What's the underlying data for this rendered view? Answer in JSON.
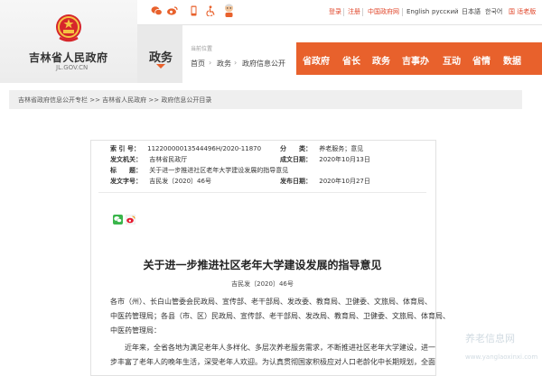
{
  "topbar": {
    "icons": [
      "wechat-icon",
      "weibo-icon",
      "mobile-icon",
      "accessibility-icon",
      "elder-mode-icon"
    ],
    "login": "登录",
    "register": "注册",
    "portal": "中国政府网",
    "languages": [
      "English",
      "русский",
      "日本語",
      "한국어"
    ],
    "old_version": "国 适老版"
  },
  "header": {
    "site_name": "吉林省人民政府",
    "domain": "JL.GOV.CN",
    "section": "政务",
    "current_position_label": "当前位置",
    "breadcrumb": [
      "首页",
      "政务",
      "政府信息公开"
    ],
    "breadcrumb_sep": "›",
    "nav": [
      "省政府",
      "省长",
      "政务",
      "吉事办",
      "互动",
      "省情",
      "数据"
    ]
  },
  "breadcrumb_strip": "吉林省政府信息公开专栏 >> 吉林省人民政府 >> 政府信息公开目录",
  "document": {
    "meta": {
      "index_label": "索 引 号：",
      "index_value": "11220000013544496H/2020-11870",
      "category_label": "分　　类：",
      "category_value": "养老服务；意见",
      "issuer_label": "发文机关：",
      "issuer_value": "吉林省民政厅",
      "date_written_label": "成文日期：",
      "date_written_value": "2020年10月13日",
      "title_label": "标　　题：",
      "title_value": "关于进一步推进社区老年大学建设发展的指导意见",
      "doc_no_label": "发文字号：",
      "doc_no_value": "吉民发〔2020〕46号",
      "pub_date_label": "发布日期：",
      "pub_date_value": "2020年10月27日"
    },
    "title": "关于进一步推进社区老年大学建设发展的指导意见",
    "doc_number": "吉民发〔2020〕46号",
    "para1": [
      "各市（州）、长白山管委会民政局、宣传部、老干部局、发改委、教育局、卫健委、文旅局、体育局、",
      "中医药管理局；各县（市、区）民政局、宣传部、老干部局、发改局、教育局、卫健委、文旅局、体育局、",
      "中医药管理局："
    ],
    "para2": [
      "　　近年来，全省各地为满足老年人多样化、多层次养老服务需求，不断推进社区老年大学建设，进一",
      "步丰富了老年人的晚年生活，深受老年人欢迎。为认真贯彻国家积极应对人口老龄化中长期规划，全面"
    ]
  },
  "watermark": {
    "text": "养老信息网",
    "url": "www.yanglaoxinxi.com"
  },
  "colors": {
    "accent": "#e8612c",
    "link_red": "#e0462a"
  }
}
